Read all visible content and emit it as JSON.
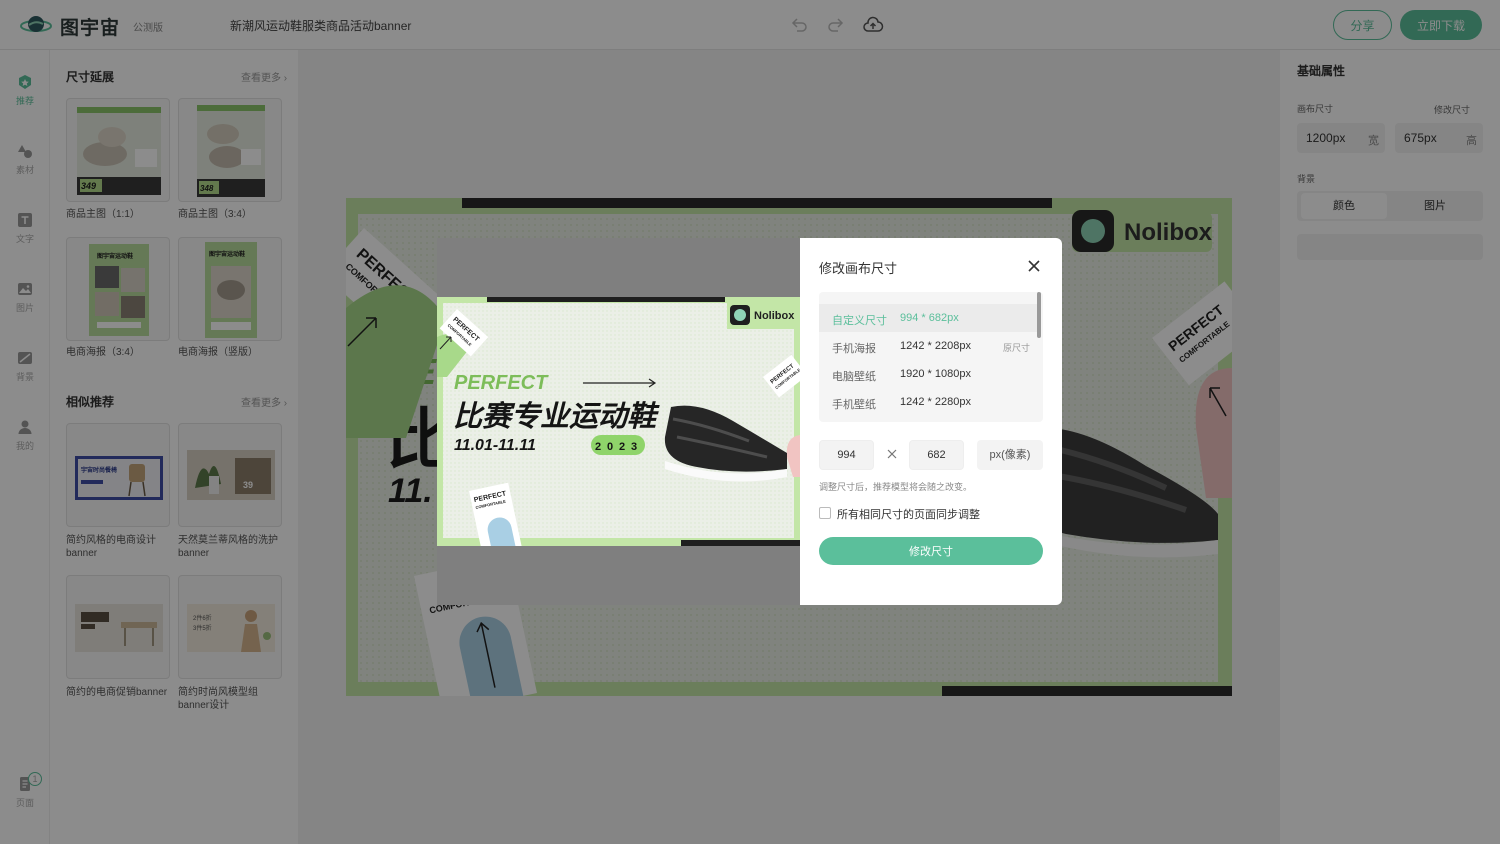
{
  "topbar": {
    "brand": "图宇宙",
    "badge": "公测版",
    "doc_title": "新潮风运动鞋服类商品活动banner",
    "share_label": "分享",
    "download_label": "立即下载"
  },
  "leftnav": {
    "items": [
      {
        "label": "推荐",
        "icon": "recommend-icon"
      },
      {
        "label": "素材",
        "icon": "shapes-icon"
      },
      {
        "label": "文字",
        "icon": "text-icon"
      },
      {
        "label": "图片",
        "icon": "image-icon"
      },
      {
        "label": "背景",
        "icon": "background-icon"
      },
      {
        "label": "我的",
        "icon": "user-icon"
      }
    ],
    "page_label": "页面",
    "page_count": "1"
  },
  "panel": {
    "size_section": {
      "title": "尺寸延展",
      "more": "查看更多",
      "items": [
        "商品主图（1:1）",
        "商品主图（3:4）",
        "电商海报（3:4）",
        "电商海报（竖版）"
      ]
    },
    "similar_section": {
      "title": "相似推荐",
      "more": "查看更多",
      "items": [
        "简约风格的电商设计banner",
        "天然莫兰蒂风格的洗护banner",
        "简约的电商促销banner",
        "简约时尚风模型组banner设计"
      ]
    },
    "thumb_text": {
      "price_a": "349",
      "price_b": "348",
      "price_c": "39",
      "brand_line": "图宇宙运动鞋",
      "chair_line": "宇宙时尚餐椅",
      "promo_a": "2件6折",
      "promo_b": "3件5折"
    }
  },
  "banner": {
    "brand": "Nolibox",
    "perfect": "PERFECT",
    "comfortable": "COMFORTABLE",
    "headline": "比赛专业运动鞋",
    "dates": "11.01-11.11",
    "year": [
      "2",
      "0",
      "2",
      "3"
    ],
    "big_partial_a": "PE",
    "big_partial_b": "比",
    "big_partial_c": "11.",
    "comfort_partial": "COMFORT"
  },
  "rpanel": {
    "title": "基础属性",
    "canvas_size_label": "画布尺寸",
    "change_size_label": "修改尺寸",
    "width_value": "1200px",
    "width_unit": "宽",
    "height_value": "675px",
    "height_unit": "高",
    "background_label": "背景",
    "tab_color": "颜色",
    "tab_image": "图片"
  },
  "dialog": {
    "title": "修改画布尺寸",
    "presets": [
      {
        "name": "自定义尺寸",
        "dim": "994 * 682px",
        "tag": ""
      },
      {
        "name": "手机海报",
        "dim": "1242 * 2208px",
        "tag": "原尺寸"
      },
      {
        "name": "电脑壁纸",
        "dim": "1920 * 1080px",
        "tag": ""
      },
      {
        "name": "手机壁纸",
        "dim": "1242 * 2280px",
        "tag": ""
      }
    ],
    "width_input": "994",
    "height_input": "682",
    "unit": "px(像素)",
    "hint": "调整尺寸后，推荐模型将会随之改变。",
    "sync_label": "所有相同尺寸的页面同步调整",
    "apply_label": "修改尺寸"
  },
  "colors": {
    "accent": "#5bbf9b",
    "banner_green": "#c9e9b1",
    "banner_dark": "#2a2a2a"
  }
}
